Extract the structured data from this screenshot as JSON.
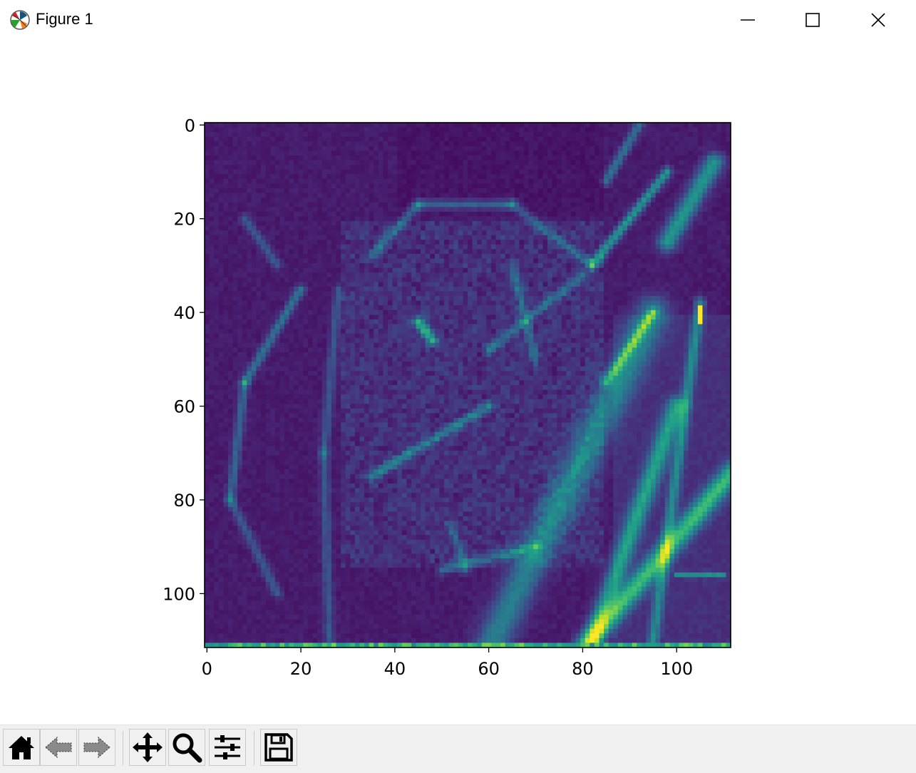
{
  "window": {
    "title": "Figure 1",
    "icon": "matplotlib-icon",
    "controls": [
      "minimize-icon",
      "maximize-icon",
      "close-icon"
    ]
  },
  "toolbar": {
    "buttons": [
      {
        "name": "home",
        "icon": "home-icon"
      },
      {
        "name": "back",
        "icon": "back-arrow-icon"
      },
      {
        "name": "forward",
        "icon": "forward-arrow-icon"
      },
      {
        "name": "pan",
        "icon": "pan-icon"
      },
      {
        "name": "zoom",
        "icon": "zoom-icon"
      },
      {
        "name": "configure-subplots",
        "icon": "sliders-icon"
      },
      {
        "name": "save",
        "icon": "save-icon"
      }
    ]
  },
  "chart_data": {
    "type": "heatmap",
    "title": "",
    "xlabel": "",
    "ylabel": "",
    "colormap": "viridis",
    "image_shape": [
      112,
      112
    ],
    "xlim": [
      -0.5,
      111.5
    ],
    "ylim": [
      111.5,
      -0.5
    ],
    "x_ticks": [
      0,
      20,
      40,
      60,
      80,
      100
    ],
    "y_ticks": [
      0,
      20,
      40,
      60,
      80,
      100
    ],
    "x_tick_labels": [
      "0",
      "20",
      "40",
      "60",
      "80",
      "100"
    ],
    "y_tick_labels": [
      "0",
      "20",
      "40",
      "60",
      "80",
      "100"
    ],
    "value_range": [
      0,
      1
    ],
    "description_colors": {
      "low": "#440154",
      "mid": "#21918c",
      "high": "#fde725"
    }
  }
}
